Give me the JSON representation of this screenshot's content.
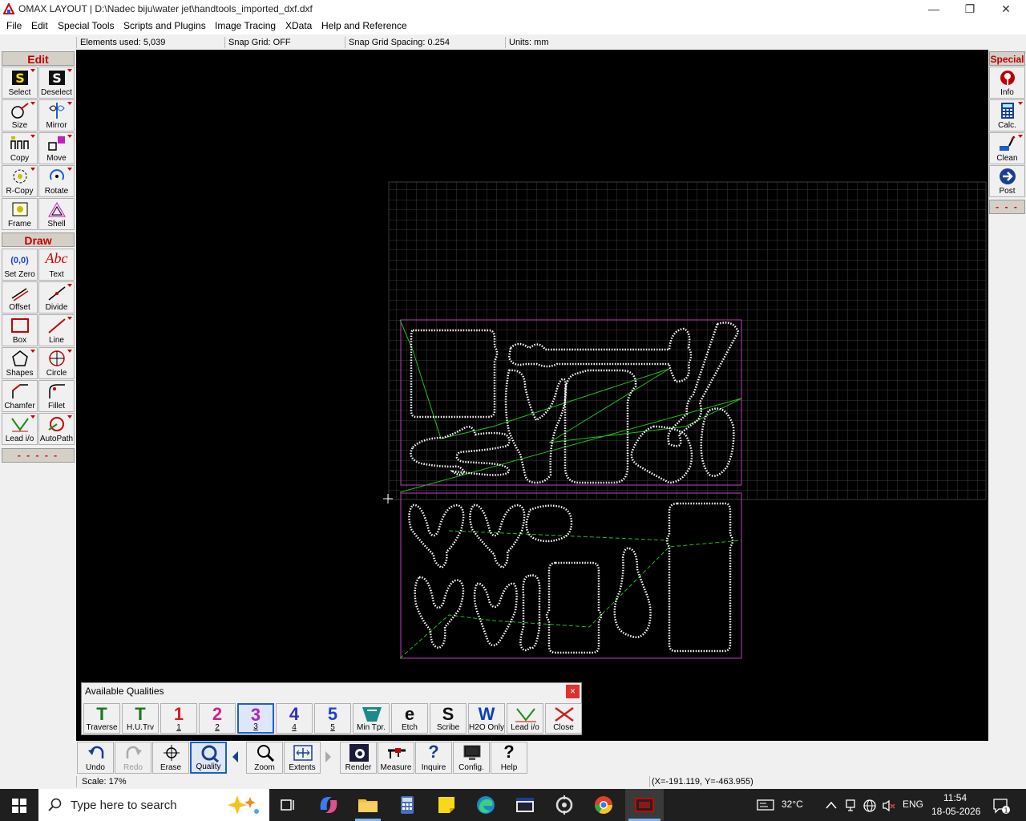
{
  "window": {
    "title": "OMAX LAYOUT | D:\\Nadec biju\\water jet\\handtools_imported_dxf.dxf",
    "minimize": "—",
    "restore": "❐",
    "close": "✕"
  },
  "menu": [
    "File",
    "Edit",
    "Special Tools",
    "Scripts and Plugins",
    "Image Tracing",
    "XData",
    "Help and Reference"
  ],
  "status_top": {
    "elements": "Elements used: 5,039",
    "snap_grid": "Snap Grid: OFF",
    "snap_spacing": "Snap Grid Spacing: 0.254",
    "units": "Units: mm"
  },
  "left_toolbox": {
    "edit_header": "Edit",
    "edit_tools": [
      "Select",
      "Deselect",
      "Size",
      "Mirror",
      "Copy",
      "Move",
      "R-Copy",
      "Rotate",
      "Frame",
      "Shell"
    ],
    "draw_header": "Draw",
    "draw_tools": [
      "Set Zero",
      "Text",
      "Offset",
      "Divide",
      "Box",
      "Line",
      "Shapes",
      "Circle",
      "Chamfer",
      "Fillet",
      "Lead i/o",
      "AutoPath"
    ],
    "more": "- - - - -",
    "set_zero_glyph": "(0,0)",
    "text_glyph": "Abc"
  },
  "right_toolbox": {
    "header": "Special",
    "tools": [
      "Info",
      "Calc.",
      "Clean",
      "Post"
    ],
    "more": "- - -"
  },
  "quality_palette": {
    "title": "Available Qualities",
    "close": "×",
    "buttons": [
      {
        "glyph": "T",
        "label": "Traverse",
        "color": "#1a7a1a"
      },
      {
        "glyph": "T",
        "label": "H.U.Trv",
        "color": "#1a7a1a"
      },
      {
        "glyph": "1",
        "label": "1",
        "color": "#d02020"
      },
      {
        "glyph": "2",
        "label": "2",
        "color": "#d0208a"
      },
      {
        "glyph": "3",
        "label": "3",
        "color": "#b020c0"
      },
      {
        "glyph": "4",
        "label": "4",
        "color": "#3030c0"
      },
      {
        "glyph": "5",
        "label": "5",
        "color": "#2040d0"
      },
      {
        "glyph": "",
        "label": "Min Tpr.",
        "color": "#1a8a8a"
      },
      {
        "glyph": "e",
        "label": "Etch",
        "color": "#111111"
      },
      {
        "glyph": "S",
        "label": "Scribe",
        "color": "#111111"
      },
      {
        "glyph": "W",
        "label": "H2O Only",
        "color": "#1040c0"
      },
      {
        "glyph": "",
        "label": "Lead i/o",
        "color": "#1a8a1a"
      },
      {
        "glyph": "",
        "label": "Close",
        "color": "#d02020"
      }
    ],
    "selected": "3"
  },
  "bottom_toolbar": [
    "Undo",
    "Redo",
    "Erase",
    "Quality",
    "Zoom",
    "Extents",
    "Render",
    "Measure",
    "Inquire",
    "Config.",
    "Help"
  ],
  "status_bottom": {
    "scale": "Scale: 17%",
    "coords": "(X=-191.119, Y=-463.955)"
  },
  "taskbar": {
    "search_placeholder": "Type here to search",
    "temperature": "32°C",
    "language": "ENG",
    "time": "11:54",
    "date": "18-05-2026"
  },
  "colors": {
    "part_outline": "#ffffff",
    "bounding_box": "#c040c0",
    "traverse_path": "#20c020",
    "grid": "#3a3a3a",
    "section_header": "#c00000"
  }
}
